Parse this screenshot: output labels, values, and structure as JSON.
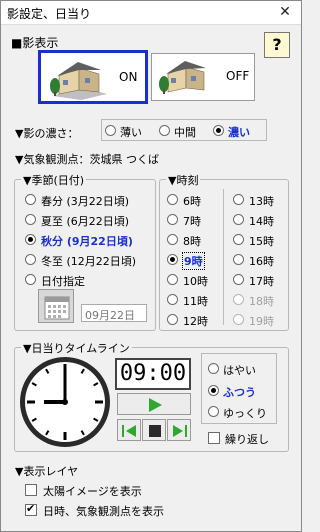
{
  "window": {
    "title": "影設定、日当り",
    "close_glyph": "✕"
  },
  "shadow_display": {
    "heading": "■影表示",
    "help_label": "?",
    "on_label": "ON",
    "off_label": "OFF"
  },
  "density": {
    "label": "▼影の濃さ：",
    "options": [
      "薄い",
      "中間",
      "濃い"
    ],
    "selected": "濃い"
  },
  "station": {
    "label": "▼気象観測点：茨城県 つくば"
  },
  "season": {
    "title": "▼季節(日付)",
    "options": [
      "春分 (3月22日頃)",
      "夏至 (6月22日頃)",
      "秋分 (9月22日頃)",
      "冬至 (12月22日頃)",
      "日付指定"
    ],
    "selected": "秋分 (9月22日頃)",
    "date_value": "09月22日"
  },
  "time": {
    "title": "▼時刻",
    "left_column": [
      "6時",
      "7時",
      "8時",
      "9時",
      "10時",
      "11時",
      "12時"
    ],
    "right_column": [
      "13時",
      "14時",
      "15時",
      "16時",
      "17時",
      "18時",
      "19時"
    ],
    "selected": "9時",
    "disabled": [
      "18時",
      "19時"
    ]
  },
  "timeline": {
    "title": "▼日当りタイムライン",
    "clock_value": "09:00",
    "speed_options": [
      "はやい",
      "ふつう",
      "ゆっくり"
    ],
    "speed_selected": "ふつう",
    "repeat_label": "繰り返し"
  },
  "layers": {
    "heading": "▼表示レイヤ",
    "items": [
      {
        "label": "太陽イメージを表示",
        "checked": false
      },
      {
        "label": "日時、気象観測点を表示",
        "checked": true
      }
    ]
  },
  "colors": {
    "accent": "#1a2fd0",
    "play_green": "#2fa82f"
  }
}
